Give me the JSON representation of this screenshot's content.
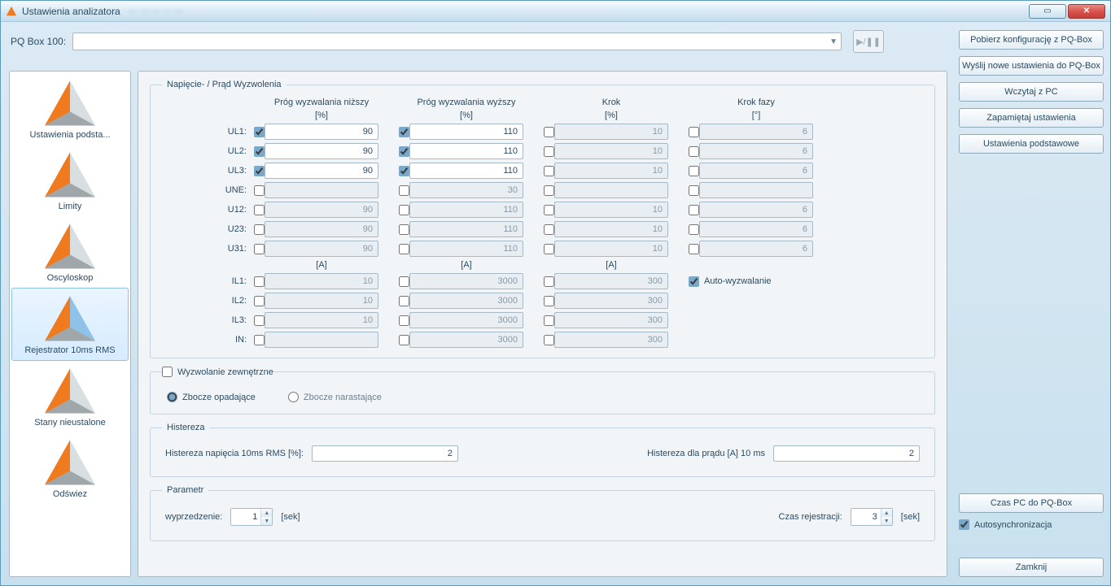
{
  "window": {
    "title": "Ustawienia analizatora"
  },
  "toolbar": {
    "pqbox_label": "PQ Box 100:",
    "btn_download": "Pobierz konfigurację z PQ-Box",
    "btn_send": "Wyślij nowe ustawienia do PQ-Box",
    "btn_load": "Wczytaj z PC",
    "btn_save": "Zapamiętaj ustawienia",
    "btn_defaults": "Ustawienia podstawowe",
    "btn_time": "Czas PC do PQ-Box",
    "cb_autosync": "Autosynchronizacja",
    "btn_close": "Zamknij"
  },
  "side": {
    "items": [
      {
        "label": "Ustawienia podsta...",
        "selected": false,
        "style": "orange"
      },
      {
        "label": "Limity",
        "selected": false,
        "style": "orange"
      },
      {
        "label": "Oscyloskop",
        "selected": false,
        "style": "orange"
      },
      {
        "label": "Rejestrator 10ms RMS",
        "selected": true,
        "style": "blue"
      },
      {
        "label": "Stany nieustalone",
        "selected": false,
        "style": "orange"
      },
      {
        "label": "Odświez",
        "selected": false,
        "style": "orange"
      }
    ]
  },
  "main": {
    "fs_trigger": "Napięcie- / Prąd Wyzwolenia",
    "cols": {
      "low": "Próg wyzwalania niższy",
      "low_u": "[%]",
      "high": "Próg wyzwalania wyższy",
      "high_u": "[%]",
      "step": "Krok",
      "step_u": "[%]",
      "phase": "Krok fazy",
      "phase_u": "[°]",
      "amp": "[A]"
    },
    "rows_volt": [
      {
        "name": "UL1:",
        "low_cb": true,
        "low": "90",
        "high_cb": true,
        "high": "110",
        "step_cb": false,
        "step": "10",
        "phase_cb": false,
        "phase": "6",
        "en": true
      },
      {
        "name": "UL2:",
        "low_cb": true,
        "low": "90",
        "high_cb": true,
        "high": "110",
        "step_cb": false,
        "step": "10",
        "phase_cb": false,
        "phase": "6",
        "en": true
      },
      {
        "name": "UL3:",
        "low_cb": true,
        "low": "90",
        "high_cb": true,
        "high": "110",
        "step_cb": false,
        "step": "10",
        "phase_cb": false,
        "phase": "6",
        "en": true
      },
      {
        "name": "UNE:",
        "low_cb": false,
        "low": "",
        "high_cb": false,
        "high": "30",
        "step_cb": false,
        "step": "",
        "phase_cb": false,
        "phase": "",
        "en": false
      },
      {
        "name": "U12:",
        "low_cb": false,
        "low": "90",
        "high_cb": false,
        "high": "110",
        "step_cb": false,
        "step": "10",
        "phase_cb": false,
        "phase": "6",
        "en": false
      },
      {
        "name": "U23:",
        "low_cb": false,
        "low": "90",
        "high_cb": false,
        "high": "110",
        "step_cb": false,
        "step": "10",
        "phase_cb": false,
        "phase": "6",
        "en": false
      },
      {
        "name": "U31:",
        "low_cb": false,
        "low": "90",
        "high_cb": false,
        "high": "110",
        "step_cb": false,
        "step": "10",
        "phase_cb": false,
        "phase": "6",
        "en": false
      }
    ],
    "rows_curr": [
      {
        "name": "IL1:",
        "low_cb": false,
        "low": "10",
        "high_cb": false,
        "high": "3000",
        "step_cb": false,
        "step": "300",
        "en": false
      },
      {
        "name": "IL2:",
        "low_cb": false,
        "low": "10",
        "high_cb": false,
        "high": "3000",
        "step_cb": false,
        "step": "300",
        "en": false
      },
      {
        "name": "IL3:",
        "low_cb": false,
        "low": "10",
        "high_cb": false,
        "high": "3000",
        "step_cb": false,
        "step": "300",
        "en": false
      },
      {
        "name": "IN:",
        "low_cb": false,
        "low": "",
        "high_cb": false,
        "high": "3000",
        "step_cb": false,
        "step": "300",
        "en": false
      }
    ],
    "auto_trigger": "Auto-wyzwalanie",
    "ext_trigger": "Wyzwolanie zewnętrzne",
    "edge_falling": "Zbocze opadające",
    "edge_rising": "Zbocze narastające",
    "fs_hyst": "Histereza",
    "hyst_v_label": "Histereza napięcia 10ms RMS  [%]:",
    "hyst_v_value": "2",
    "hyst_i_label": "Histereza dla prądu [A] 10 ms",
    "hyst_i_value": "2",
    "fs_param": "Parametr",
    "pre_label": "wyprzedzenie:",
    "pre_value": "1",
    "sek": "[sek]",
    "rec_label": "Czas rejestracji:",
    "rec_value": "3"
  }
}
